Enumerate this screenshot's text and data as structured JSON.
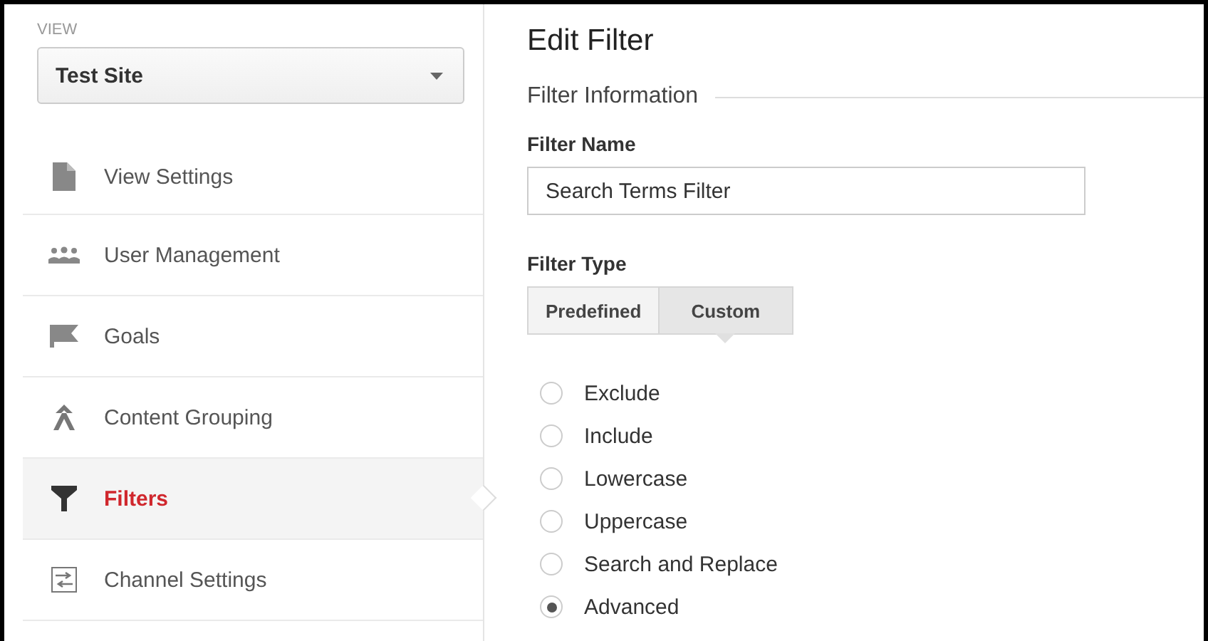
{
  "sidebar": {
    "view_label": "VIEW",
    "view_select": {
      "value": "Test Site"
    },
    "items": [
      {
        "label": "View Settings",
        "selected": false
      },
      {
        "label": "User Management",
        "selected": false
      },
      {
        "label": "Goals",
        "selected": false
      },
      {
        "label": "Content Grouping",
        "selected": false
      },
      {
        "label": "Filters",
        "selected": true
      },
      {
        "label": "Channel Settings",
        "selected": false
      }
    ]
  },
  "main": {
    "title": "Edit Filter",
    "section": "Filter Information",
    "name_label": "Filter Name",
    "name_field": {
      "value": "Search Terms Filter"
    },
    "type_label": "Filter Type",
    "tabs": [
      {
        "label": "Predefined",
        "selected": false
      },
      {
        "label": "Custom",
        "selected": true
      }
    ],
    "options": [
      {
        "label": "Exclude",
        "selected": false
      },
      {
        "label": "Include",
        "selected": false
      },
      {
        "label": "Lowercase",
        "selected": false
      },
      {
        "label": "Uppercase",
        "selected": false
      },
      {
        "label": "Search and Replace",
        "selected": false
      },
      {
        "label": "Advanced",
        "selected": true
      }
    ]
  }
}
